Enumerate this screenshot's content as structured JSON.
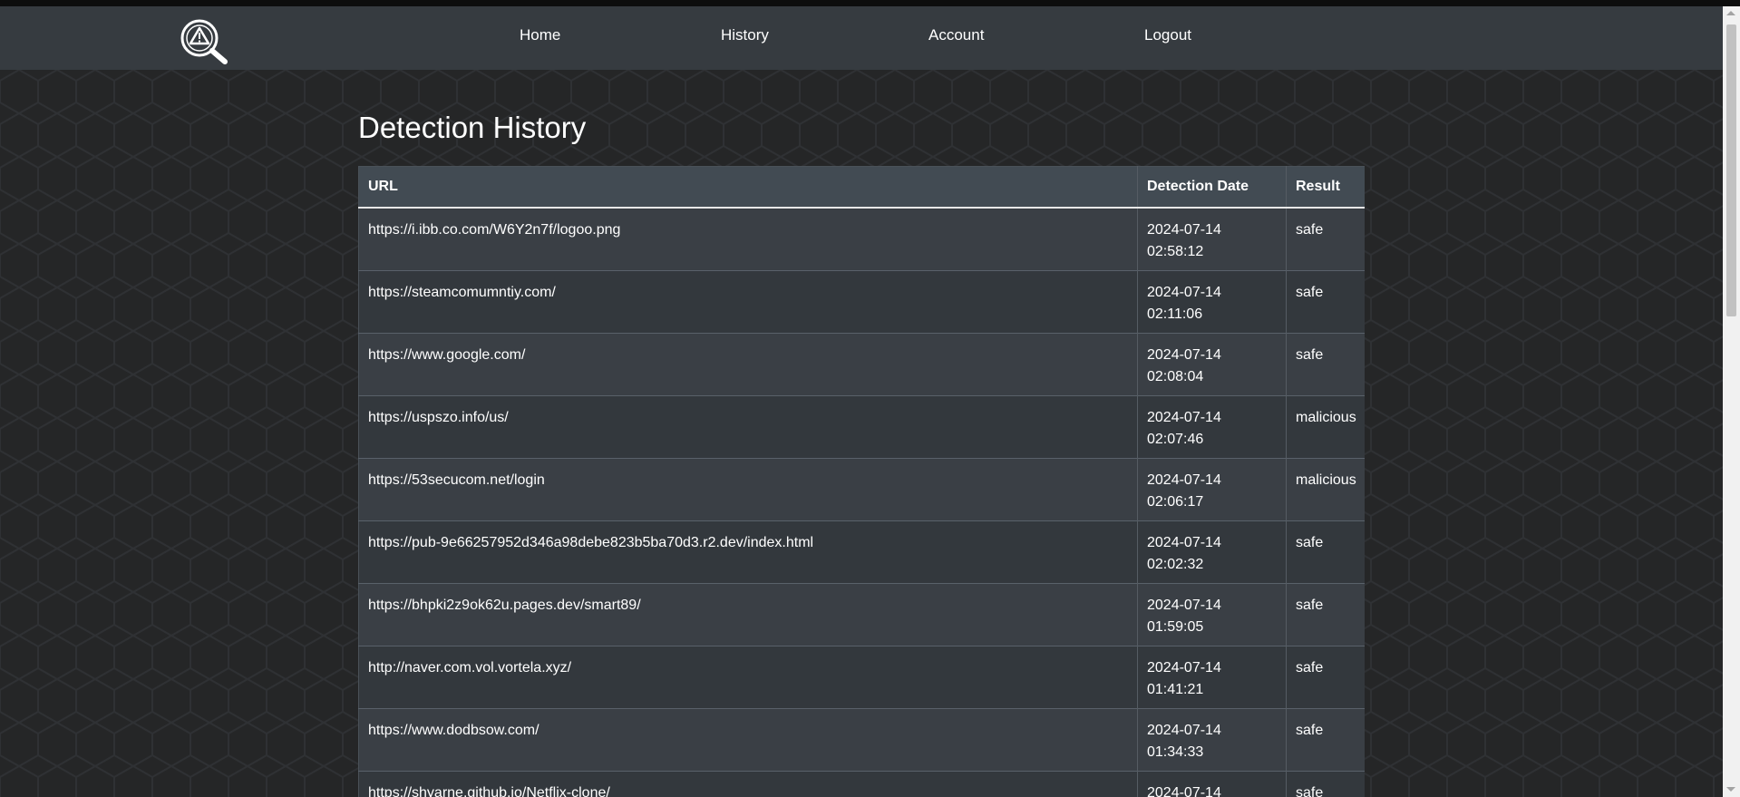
{
  "nav": {
    "logo_icon": "warning-magnifier-logo-icon",
    "links": [
      "Home",
      "History",
      "Account",
      "Logout"
    ]
  },
  "page": {
    "title": "Detection History"
  },
  "table": {
    "columns": [
      "URL",
      "Detection Date",
      "Result"
    ],
    "rows": [
      {
        "url": "https://i.ibb.co.com/W6Y2n7f/logoo.png",
        "date": "2024-07-14",
        "time": "02:58:12",
        "result": "safe"
      },
      {
        "url": "https://steamcomumntiy.com/",
        "date": "2024-07-14",
        "time": "02:11:06",
        "result": "safe"
      },
      {
        "url": "https://www.google.com/",
        "date": "2024-07-14",
        "time": "02:08:04",
        "result": "safe"
      },
      {
        "url": "https://uspszo.info/us/",
        "date": "2024-07-14",
        "time": "02:07:46",
        "result": "malicious"
      },
      {
        "url": "https://53secucom.net/login",
        "date": "2024-07-14",
        "time": "02:06:17",
        "result": "malicious"
      },
      {
        "url": "https://pub-9e66257952d346a98debe823b5ba70d3.r2.dev/index.html",
        "date": "2024-07-14",
        "time": "02:02:32",
        "result": "safe"
      },
      {
        "url": "https://bhpki2z9ok62u.pages.dev/smart89/",
        "date": "2024-07-14",
        "time": "01:59:05",
        "result": "safe"
      },
      {
        "url": "http://naver.com.vol.vortela.xyz/",
        "date": "2024-07-14",
        "time": "01:41:21",
        "result": "safe"
      },
      {
        "url": "https://www.dodbsow.com/",
        "date": "2024-07-14",
        "time": "01:34:33",
        "result": "safe"
      },
      {
        "url": "https://shyarne.github.io/Netflix-clone/",
        "date": "2024-07-14",
        "time": "",
        "result": "safe"
      }
    ]
  },
  "colors": {
    "navbar": "#363b40",
    "background": "#252627",
    "table_header": "#424b53",
    "row_odd": "#3a3f45",
    "row_even": "#33383d"
  }
}
